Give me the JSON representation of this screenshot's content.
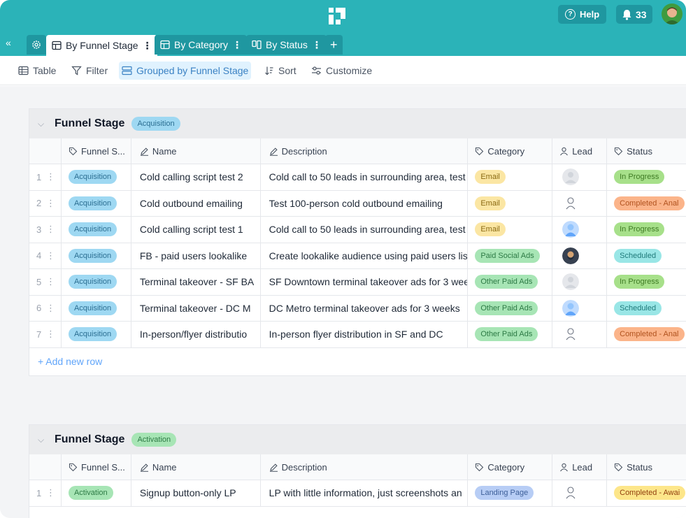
{
  "app": {
    "help_label": "Help",
    "notification_count": "33"
  },
  "tabs": [
    {
      "label": "By Funnel Stage",
      "active": true
    },
    {
      "label": "By Category",
      "active": false
    },
    {
      "label": "By Status",
      "active": false
    }
  ],
  "toolbar": {
    "table_label": "Table",
    "filter_label": "Filter",
    "grouped_label": "Grouped by Funnel Stage",
    "sort_label": "Sort",
    "customize_label": "Customize"
  },
  "columns": {
    "funnel_stage": "Funnel S...",
    "name": "Name",
    "description": "Description",
    "category": "Category",
    "lead": "Lead",
    "status": "Status"
  },
  "groups": [
    {
      "title": "Funnel Stage",
      "stage": "Acquisition",
      "add_row_label": "+ Add new row",
      "rows": [
        {
          "num": "1",
          "stage": "Acquisition",
          "name": "Cold calling script test 2",
          "description": "Cold call to 50 leads in surrounding area, test",
          "category": "Email",
          "status": "In Progress"
        },
        {
          "num": "2",
          "stage": "Acquisition",
          "name": "Cold outbound emailing",
          "description": "Test 100-person cold outbound emailing",
          "category": "Email",
          "status": "Completed - Anal"
        },
        {
          "num": "3",
          "stage": "Acquisition",
          "name": "Cold calling script test 1",
          "description": "Cold call to 50 leads in surrounding area, test",
          "category": "Email",
          "status": "In Progress"
        },
        {
          "num": "4",
          "stage": "Acquisition",
          "name": "FB - paid users lookalike",
          "description": "Create lookalike audience using paid users lis",
          "category": "Paid Social Ads",
          "status": "Scheduled"
        },
        {
          "num": "5",
          "stage": "Acquisition",
          "name": "Terminal takeover - SF BA",
          "description": "SF Downtown terminal takeover ads for 3 wee",
          "category": "Other Paid Ads",
          "status": "In Progress"
        },
        {
          "num": "6",
          "stage": "Acquisition",
          "name": "Terminal takeover - DC M",
          "description": "DC Metro terminal takeover ads for 3 weeks",
          "category": "Other Paid Ads",
          "status": "Scheduled"
        },
        {
          "num": "7",
          "stage": "Acquisition",
          "name": "In-person/flyer distributio",
          "description": "In-person flyer distribution in SF and DC",
          "category": "Other Paid Ads",
          "status": "Completed - Anal"
        }
      ]
    },
    {
      "title": "Funnel Stage",
      "stage": "Activation",
      "rows": [
        {
          "num": "1",
          "stage": "Activation",
          "name": "Signup button-only LP",
          "description": "LP with little information, just screenshots an",
          "category": "Landing Page",
          "status": "Completed - Awai"
        }
      ]
    }
  ],
  "colors": {
    "brand": "#2bb3b8",
    "brand_dark": "#1f97a0",
    "link": "#60a5fa"
  }
}
